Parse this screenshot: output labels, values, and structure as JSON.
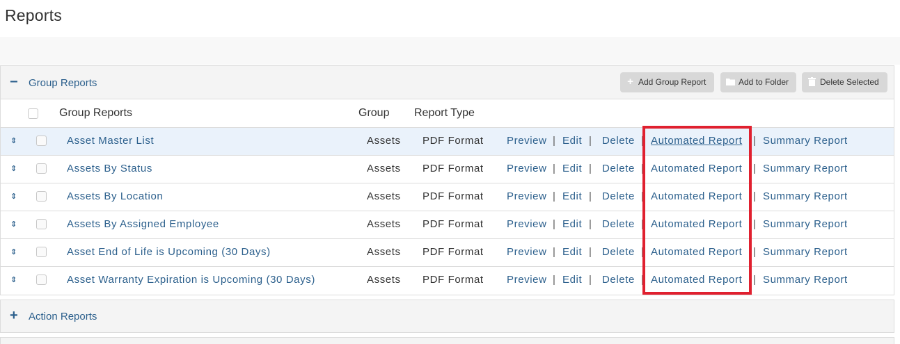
{
  "page": {
    "title": "Reports"
  },
  "group_panel": {
    "toggle_symbol": "−",
    "title": "Group Reports",
    "buttons": {
      "add_group_report": "Add Group Report",
      "add_to_folder": "Add to Folder",
      "delete_selected": "Delete Selected"
    },
    "columns": {
      "name": "Group Reports",
      "group": "Group",
      "report_type": "Report Type"
    },
    "rows": [
      {
        "name": "Asset Master List",
        "group": "Assets",
        "type": "PDF Format",
        "preview": "Preview",
        "edit": "Edit",
        "delete": "Delete",
        "automated": "Automated Report",
        "summary": "Summary Report"
      },
      {
        "name": "Assets By Status",
        "group": "Assets",
        "type": "PDF Format",
        "preview": "Preview",
        "edit": "Edit",
        "delete": "Delete",
        "automated": "Automated Report",
        "summary": "Summary Report"
      },
      {
        "name": "Assets By Location",
        "group": "Assets",
        "type": "PDF Format",
        "preview": "Preview",
        "edit": "Edit",
        "delete": "Delete",
        "automated": "Automated Report",
        "summary": "Summary Report"
      },
      {
        "name": "Assets By Assigned Employee",
        "group": "Assets",
        "type": "PDF Format",
        "preview": "Preview",
        "edit": "Edit",
        "delete": "Delete",
        "automated": "Automated Report",
        "summary": "Summary Report"
      },
      {
        "name": "Asset End of Life is Upcoming (30 Days)",
        "group": "Assets",
        "type": "PDF Format",
        "preview": "Preview",
        "edit": "Edit",
        "delete": "Delete",
        "automated": "Automated Report",
        "summary": "Summary Report"
      },
      {
        "name": "Asset Warranty Expiration is Upcoming (30 Days)",
        "group": "Assets",
        "type": "PDF Format",
        "preview": "Preview",
        "edit": "Edit",
        "delete": "Delete",
        "automated": "Automated Report",
        "summary": "Summary Report"
      }
    ],
    "link_separator": "|"
  },
  "action_panel": {
    "toggle_symbol": "+",
    "title": "Action Reports"
  },
  "colors": {
    "link": "#2b5f8c",
    "highlight_box": "#e0202f",
    "selected_row": "#eaf2fb"
  }
}
